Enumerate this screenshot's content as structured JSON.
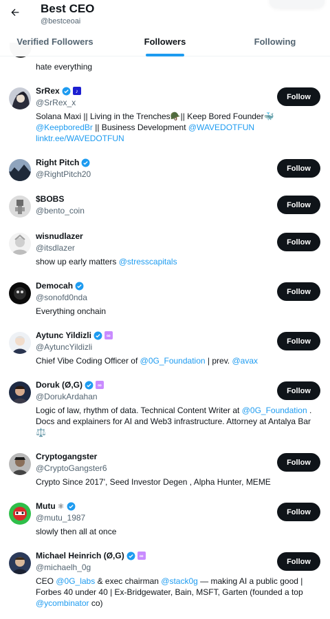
{
  "header": {
    "title": "Best CEO",
    "handle": "@bestceoai"
  },
  "tabs": [
    {
      "label": "Verified Followers",
      "active": false
    },
    {
      "label": "Followers",
      "active": true
    },
    {
      "label": "Following",
      "active": false
    }
  ],
  "partial_item": {
    "bio": "hate everything"
  },
  "follow_label": "Follow",
  "colors": {
    "accent": "#1d9bf0",
    "button": "#0f1419"
  },
  "users": [
    {
      "name": "SrRex",
      "username": "@SrRex_x",
      "bio1": "Solana Maxi || Living in the Trenches🪖|| Keep Bored Founder🐳",
      "bio2a": "@KeepboredBr",
      "bio2b": " || Business Development ",
      "bio2c": "@WAVEDOTFUN",
      "bio3": "linktr.ee/WAVEDOTFUN"
    },
    {
      "name": "Right Pitch",
      "username": "@RightPitch20"
    },
    {
      "name": "$BOBS",
      "username": "@bento_coin"
    },
    {
      "name": "wisnudlazer",
      "username": "@itsdlazer",
      "bio1": "show up early matters ",
      "bio1link": "@stresscapitals"
    },
    {
      "name": "Democah",
      "username": "@sonofd0nda",
      "bio1": "Everything onchain"
    },
    {
      "name": "Aytunc Yildizli",
      "username": "@AytuncYildizli",
      "bio1": "Chief Vibe Coding Officer of ",
      "bio1link": "@0G_Foundation",
      "bio1b": " | prev. ",
      "bio1link2": "@avax"
    },
    {
      "name": "Doruk (Ø,G)",
      "username": "@DorukArdahan",
      "bio1": "Logic of law, rhythm of data. Technical Content Writer at ",
      "bio1link": "@0G_Foundation",
      "bio1b": " .",
      "bio2": "Docs and explainers for AI and Web3 infrastructure. Attorney at Antalya Bar",
      "bio3": "⚖️"
    },
    {
      "name": "Cryptogangster",
      "username": "@CryptoGangster6",
      "bio1": "Crypto Since 2017', Seed Investor Degen ,   Alpha Hunter,   MEME"
    },
    {
      "name": "Mutu",
      "username": "@mutu_1987",
      "bio1": "slowly then all at once"
    },
    {
      "name": "Michael Heinrich (Ø,G)",
      "username": "@michaelh_0g",
      "bio1a": "CEO ",
      "bio1link": "@0G_labs",
      "bio1b": " & exec chairman ",
      "bio1link2": "@stack0g",
      "bio1c": " — making AI a public good |",
      "bio2": "Forbes 40 under 40 | Ex-Bridgewater, Bain, MSFT, Garten (founded a top",
      "bio3link": "@ycombinator",
      "bio3": " co)"
    }
  ]
}
